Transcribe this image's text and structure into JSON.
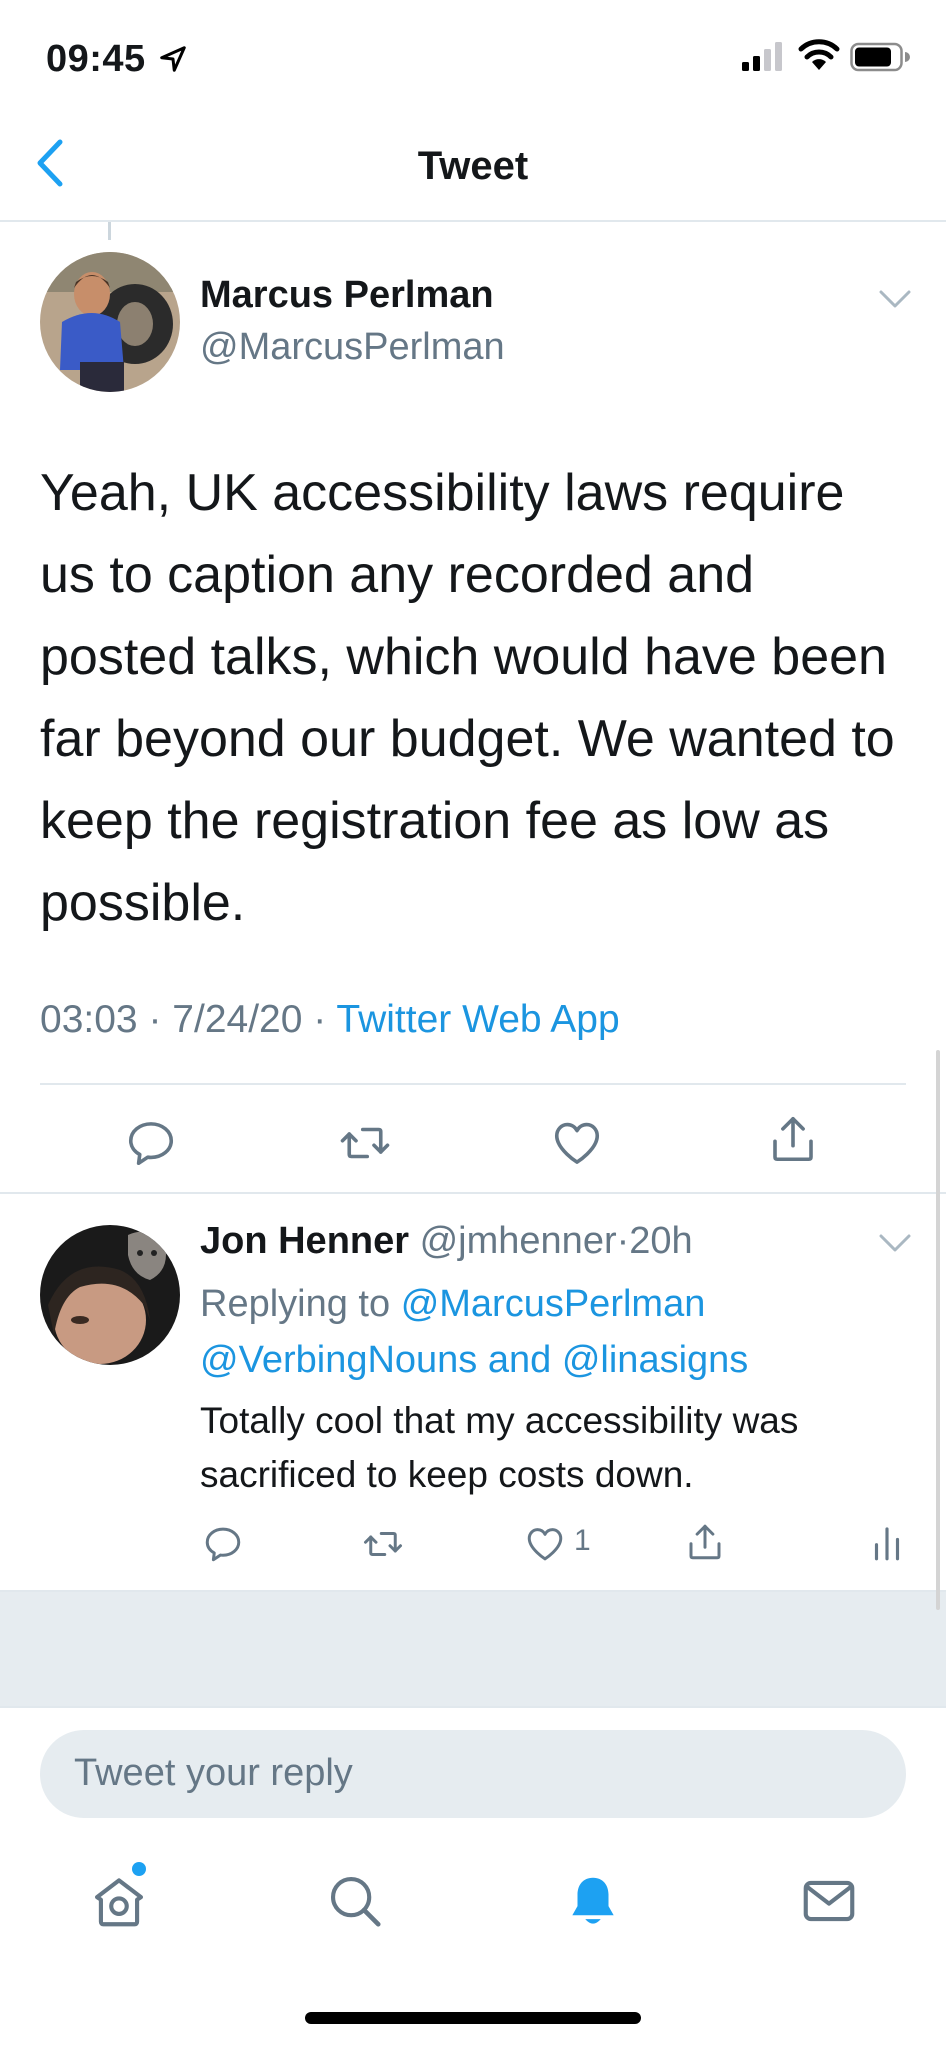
{
  "status_bar": {
    "time": "09:45"
  },
  "header": {
    "title": "Tweet"
  },
  "main_tweet": {
    "author_name": "Marcus Perlman",
    "author_handle": "@MarcusPerlman",
    "text": "Yeah, UK accessibility laws require us to caption any recorded and posted talks, which would have been far beyond our budget. We wanted to keep the registration fee as low as possible.",
    "time": "03:03",
    "date": "7/24/20",
    "source": "Twitter Web App",
    "separator": "·"
  },
  "reply_tweet": {
    "author_name": "Jon Henner",
    "author_handle": "@jmhenner",
    "age": "20h",
    "replying_to_label": "Replying to",
    "mention1": "@MarcusPerlman",
    "mention2": "@VerbingNouns",
    "and_label": "and",
    "mention3": "@linasigns",
    "text": "Totally cool that my accessibility  was sacrificed to keep costs down.",
    "like_count": "1"
  },
  "reply_input": {
    "placeholder": "Tweet your reply"
  },
  "icons": {
    "reply": "reply-icon",
    "retweet": "retweet-icon",
    "like": "heart-icon",
    "share": "share-icon",
    "analytics": "analytics-icon",
    "home": "home-icon",
    "search": "search-icon",
    "notifications": "bell-icon",
    "messages": "mail-icon"
  },
  "colors": {
    "accent": "#1da1f2",
    "link": "#1b95e0",
    "secondary_text": "#657786",
    "divider": "#e1e8ed"
  }
}
